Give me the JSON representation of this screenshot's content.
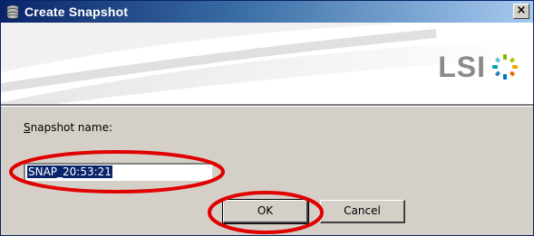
{
  "window": {
    "title": "Create Snapshot",
    "close_glyph": "×",
    "icon": "database-icon"
  },
  "banner": {
    "logo_text": "LSI",
    "logo_icon": "lsi-star-icon"
  },
  "form": {
    "label_mnemonic": "S",
    "label_rest": "napshot name:",
    "snapshot_name_value": "SNAP_20:53:21"
  },
  "buttons": {
    "ok_label": "OK",
    "cancel_label": "Cancel"
  },
  "colors": {
    "title_start": "#0a246a",
    "title_end": "#a6caf0",
    "dialog_bg": "#d4d0c8",
    "selection": "#0a246a",
    "annotation_red": "#e00000"
  }
}
